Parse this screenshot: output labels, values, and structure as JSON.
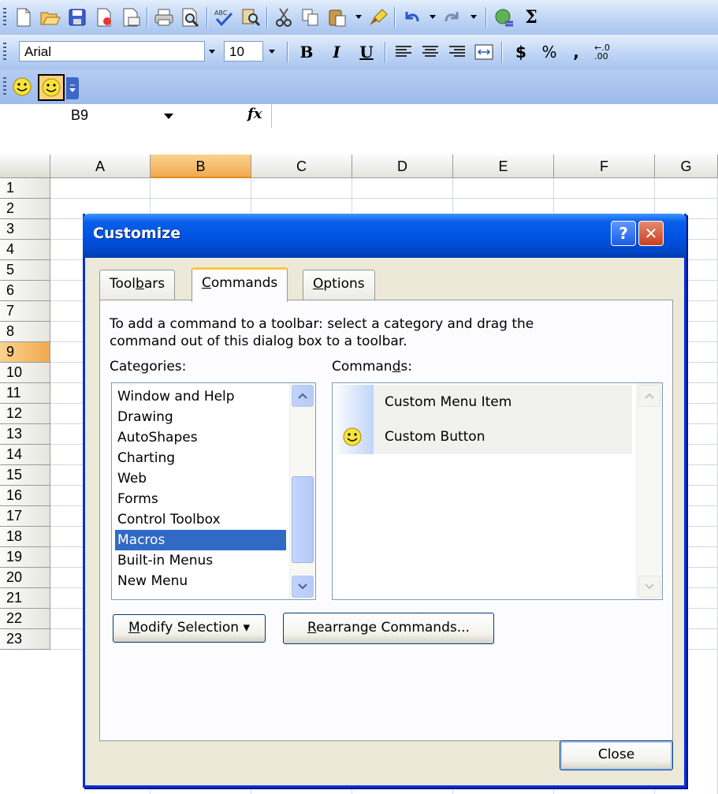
{
  "toolbar": {
    "font_name": "Arial",
    "font_size": "10",
    "bold_label": "B",
    "italic_label": "I",
    "underline_label": "U",
    "currency_label": "$",
    "percent_label": "%",
    "comma_label": ","
  },
  "custom_toolbar": {
    "buttons": [
      "smiley-button-1",
      "smiley-button-2"
    ]
  },
  "formula_bar": {
    "name_box": "B9",
    "fx_label": "fx"
  },
  "sheet": {
    "columns": [
      "A",
      "B",
      "C",
      "D",
      "E",
      "F",
      "G"
    ],
    "selected_column": "B",
    "rows": [
      "1",
      "2",
      "3",
      "4",
      "5",
      "6",
      "7",
      "8",
      "9",
      "10",
      "11",
      "12",
      "13",
      "14",
      "15",
      "16",
      "17",
      "18",
      "19",
      "20",
      "21",
      "22",
      "23"
    ],
    "selected_row": "9"
  },
  "dialog": {
    "title": "Customize",
    "help_glyph": "?",
    "close_glyph": "✕",
    "tabs": [
      {
        "label_pre": "Tool",
        "label_key": "b",
        "label_post": "ars"
      },
      {
        "label_pre": "",
        "label_key": "C",
        "label_post": "ommands"
      },
      {
        "label_pre": "",
        "label_key": "O",
        "label_post": "ptions"
      }
    ],
    "instructions_line1": "To add a command to a toolbar: select a category and drag the",
    "instructions_line2": "command out of this dialog box to a toolbar.",
    "categories_label_pre": "Cate",
    "categories_label_key": "g",
    "categories_label_post": "ories:",
    "commands_label_pre": "Comman",
    "commands_label_key": "d",
    "commands_label_post": "s:",
    "categories": [
      "Window and Help",
      "Drawing",
      "AutoShapes",
      "Charting",
      "Web",
      "Forms",
      "Control Toolbox",
      "Macros",
      "Built-in Menus",
      "New Menu"
    ],
    "selected_category": "Macros",
    "commands": [
      "Custom Menu Item",
      "Custom Button"
    ],
    "modify_selection_pre": "",
    "modify_selection_key": "M",
    "modify_selection_post": "odify Selection ▾",
    "rearrange_pre": "",
    "rearrange_key": "R",
    "rearrange_post": "earrange Commands...",
    "close_button": "Close"
  }
}
